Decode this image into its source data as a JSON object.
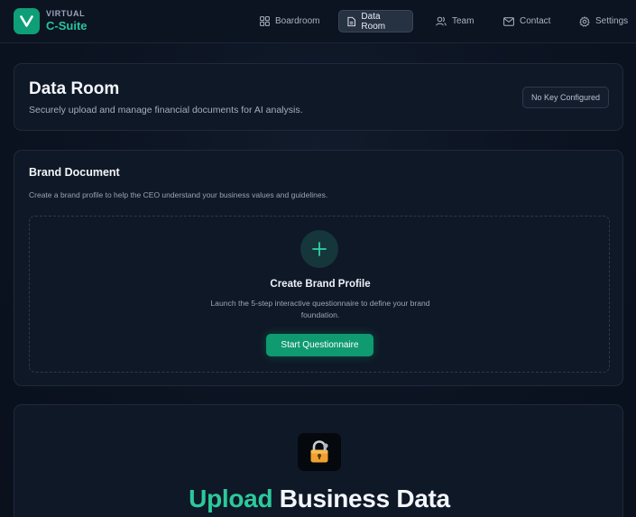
{
  "app": {
    "logo_small": "VIRTUAL",
    "logo_main": "C-Suite",
    "logo_letter": "V"
  },
  "nav": {
    "items": [
      {
        "label": "Boardroom",
        "icon": "grid-icon"
      },
      {
        "label": "Data Room",
        "icon": "document-icon",
        "active": true
      },
      {
        "label": "Team",
        "icon": "users-icon"
      },
      {
        "label": "Contact",
        "icon": "mail-icon"
      },
      {
        "label": "Settings",
        "icon": "gear-icon"
      }
    ]
  },
  "header": {
    "title": "Data Room",
    "subtitle": "Securely upload and manage financial documents for AI analysis.",
    "key_status": "No Key Configured"
  },
  "brand": {
    "title": "Brand Document",
    "description": "Create a brand profile to help the CEO understand your business values and guidelines.",
    "create_title": "Create Brand Profile",
    "create_desc": "Launch the 5-step interactive questionnaire to define your brand foundation.",
    "button_label": "Start Questionnaire"
  },
  "upload": {
    "title_accent": "Upload",
    "title_rest": "Business Data",
    "icon": "lock-icon"
  },
  "colors": {
    "accent": "#0e9e78",
    "accent_text": "#25c59a",
    "background": "#0b1220"
  }
}
